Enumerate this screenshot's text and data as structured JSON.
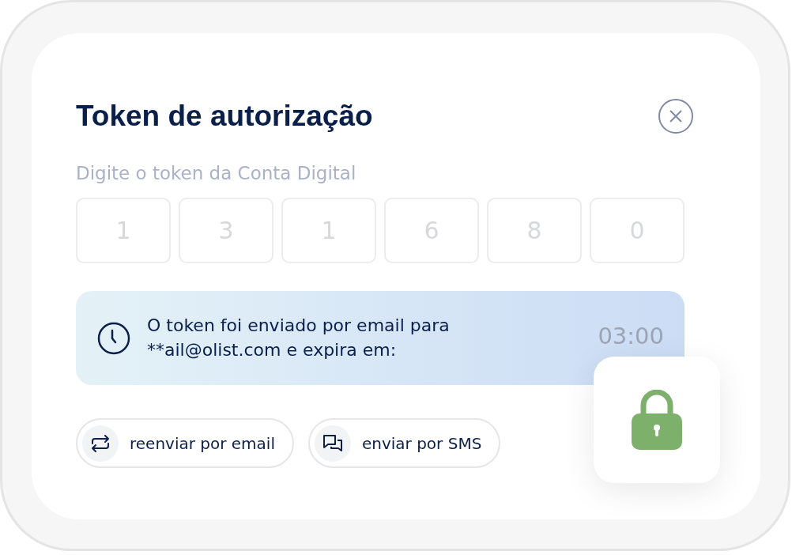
{
  "dialog": {
    "title": "Token de autorização",
    "prompt": "Digite o token da Conta Digital",
    "digits": [
      {
        "placeholder": "1"
      },
      {
        "placeholder": "3"
      },
      {
        "placeholder": "1"
      },
      {
        "placeholder": "6"
      },
      {
        "placeholder": "8"
      },
      {
        "placeholder": "0"
      }
    ],
    "notice": {
      "text": "O token foi enviado por email para **ail@olist.com e expira em:",
      "timer": "03:00"
    },
    "actions": [
      {
        "kind": "resend",
        "label": "reenviar por email"
      },
      {
        "kind": "sms",
        "label": "enviar por SMS"
      }
    ]
  }
}
